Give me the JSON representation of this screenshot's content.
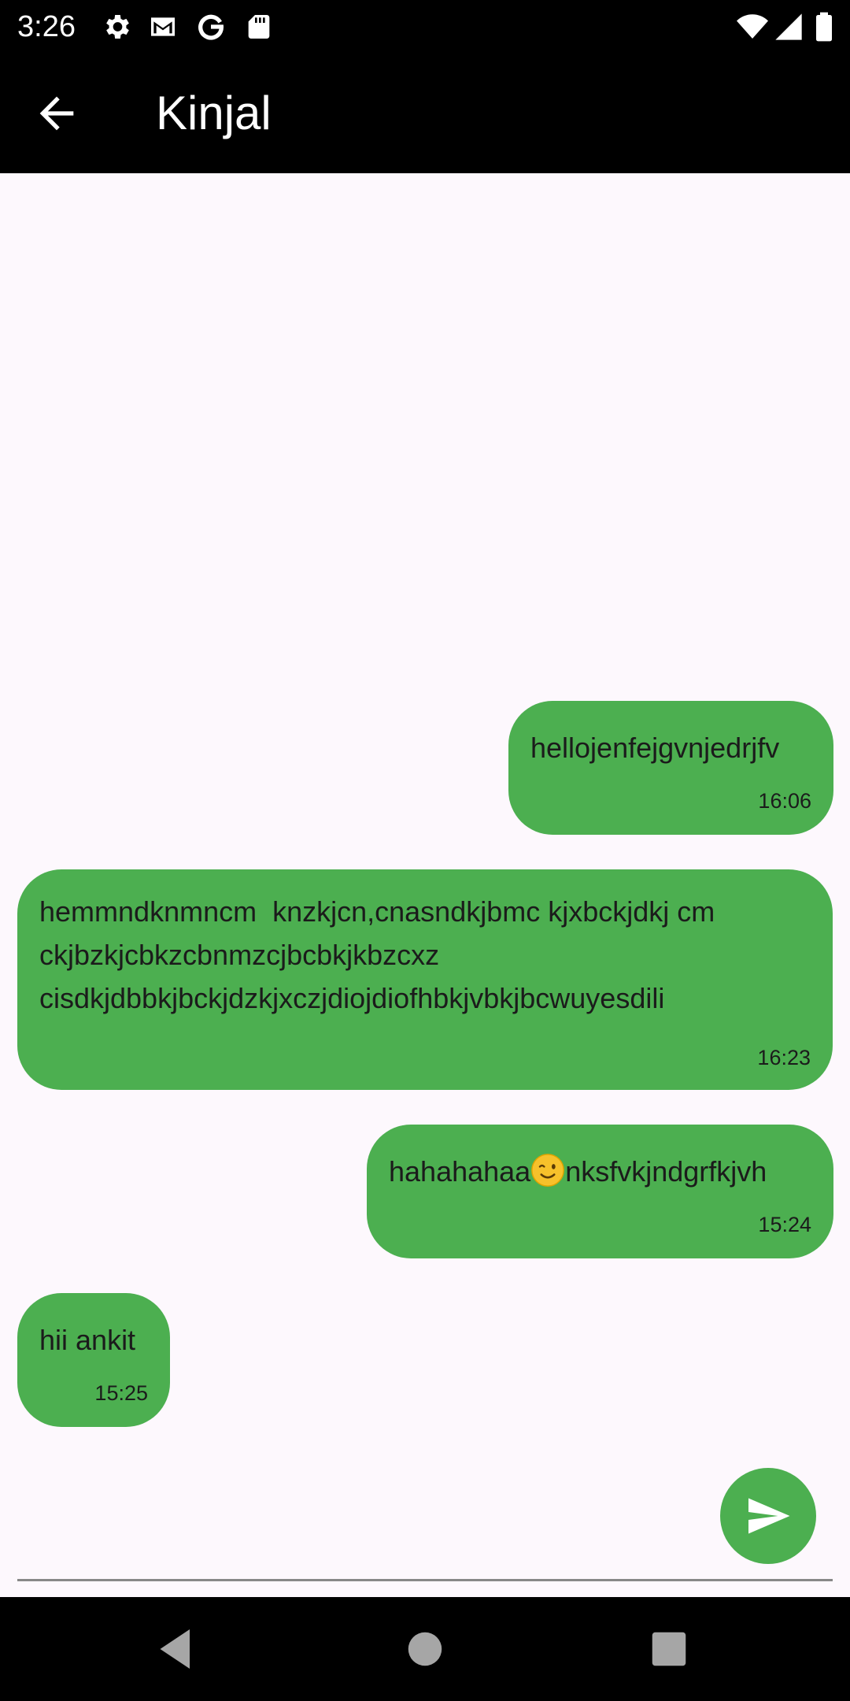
{
  "status_bar": {
    "time": "3:26",
    "left_icons": [
      "settings-icon",
      "gmail-icon",
      "google-icon",
      "sd-card-icon"
    ],
    "right_icons": [
      "wifi-icon",
      "signal-icon",
      "battery-icon"
    ]
  },
  "app_bar": {
    "back_icon": "arrow-back-icon",
    "title": "Kinjal",
    "background": "#000000"
  },
  "messages": [
    {
      "text": "hellojenfejgvnjedrjfv",
      "time": "16:06",
      "align": "right"
    },
    {
      "lines": [
        "hemmndknmncm  knzkjcn,cnasndkjbmc kjxbckjdkj cm",
        "ckjbzkjcbkzcbnmzcjbcbkjkbzcxz",
        "cisdkjdbbkjbckjdzkjxczjdiojdiofhbkjvbkjbcwuyesdili"
      ],
      "time": "16:23",
      "align": "left"
    },
    {
      "text_before": "hahahahaa",
      "emoji": "winking-face",
      "text_after": "nksfvkjndgrfkjvh",
      "time": "15:24",
      "align": "right"
    },
    {
      "text": "hii ankit",
      "time": "15:25",
      "align": "left"
    }
  ],
  "composer": {
    "placeholder": "",
    "value": "",
    "send_icon": "send-icon"
  },
  "nav_bar": {
    "buttons": [
      "back-triangle-icon",
      "home-circle-icon",
      "recents-square-icon"
    ]
  },
  "colors": {
    "bubble": "#4caf50",
    "chat_background": "#fdf8fd",
    "bar": "#000000",
    "text": "#1b1b1b"
  }
}
